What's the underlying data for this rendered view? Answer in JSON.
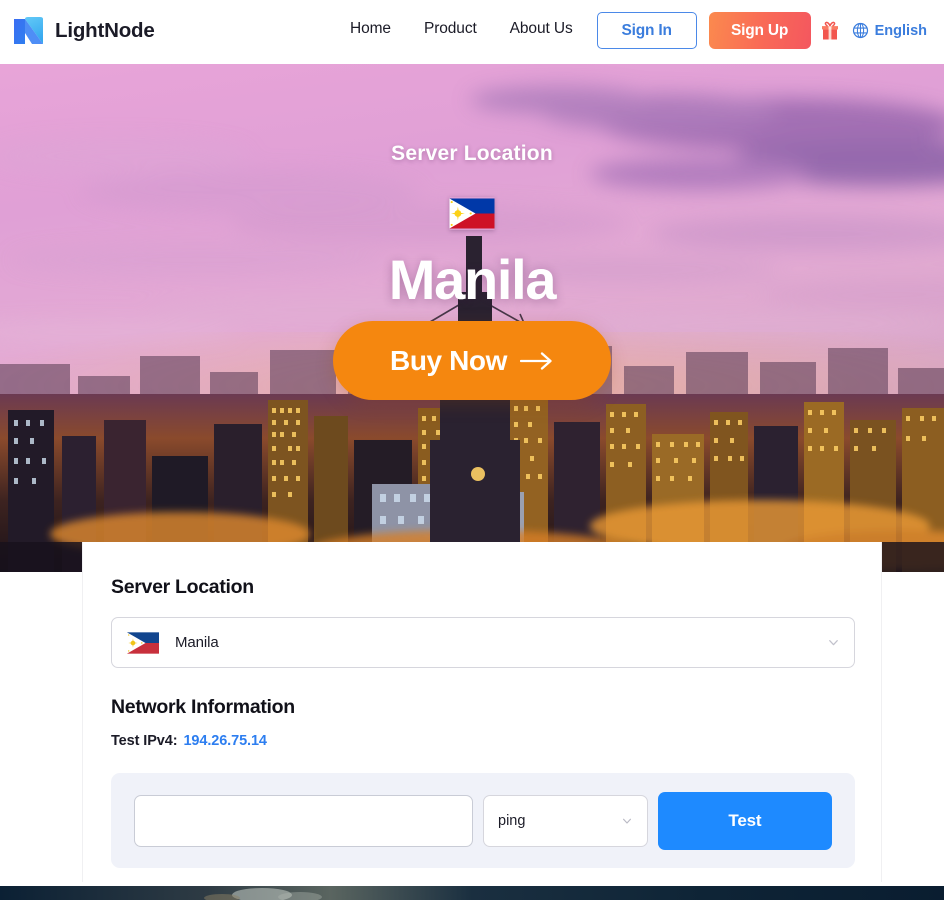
{
  "header": {
    "brand": "LightNode",
    "logo_icon": "lightnode-logo-icon",
    "nav": [
      {
        "label": "Home"
      },
      {
        "label": "Product"
      },
      {
        "label": "About Us"
      }
    ],
    "sign_in_label": "Sign In",
    "sign_up_label": "Sign Up",
    "gift_icon": "gift-icon",
    "globe_icon": "globe-icon",
    "language_label": "English"
  },
  "hero": {
    "eyebrow": "Server Location",
    "flag_icon": "philippines-flag-icon",
    "city": "Manila",
    "buy_label": "Buy Now",
    "buy_arrow_icon": "arrow-right-icon"
  },
  "card": {
    "server_location_title": "Server Location",
    "location_select": {
      "flag_icon": "philippines-flag-icon",
      "value": "Manila",
      "chevron_icon": "chevron-down-icon"
    },
    "network_title": "Network Information",
    "ip_label": "Test IPv4:",
    "ip_value": "194.26.75.14",
    "test_tool": {
      "host_value": "",
      "host_placeholder": "",
      "mode_value": "ping",
      "mode_chevron_icon": "chevron-down-icon",
      "test_button_label": "Test"
    }
  },
  "colors": {
    "brand_dark": "#1b1b27",
    "accent_blue": "#3b7ddd",
    "link_blue": "#2d7ef0",
    "test_blue": "#1e8aff",
    "buy_orange": "#f5870f",
    "signup_gradient_start": "#fb8a4e",
    "signup_gradient_end": "#f4575f",
    "panel_bg": "#f0f2f9",
    "footer_navy": "#0d2438"
  }
}
